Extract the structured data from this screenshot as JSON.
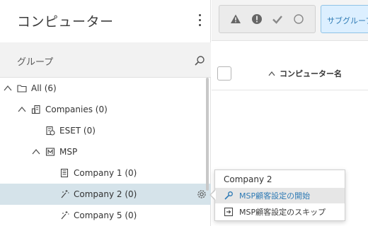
{
  "left_panel": {
    "title": "コンピューター",
    "group_label": "グループ"
  },
  "tree": [
    {
      "label": "All (6)",
      "icon": "folder-icon",
      "expanded": true
    },
    {
      "label": "Companies (0)",
      "icon": "building-group-icon",
      "expanded": true
    },
    {
      "label": "ESET (0)",
      "icon": "company-icon"
    },
    {
      "label": "MSP",
      "icon": "msp-icon",
      "expanded": true
    },
    {
      "label": "Company 1 (0)",
      "icon": "building-icon"
    },
    {
      "label": "Company 2 (0)",
      "icon": "wand-icon",
      "selected": true
    },
    {
      "label": "Company 5 (0)",
      "icon": "wand-icon"
    }
  ],
  "filters": {
    "subgroup_label": "サブグループ"
  },
  "table": {
    "column_header": "コンピューター名"
  },
  "context_menu": {
    "title": "Company 2",
    "items": [
      {
        "label": "MSP顧客設定の開始",
        "icon": "wrench-icon"
      },
      {
        "label": "MSP顧客設定のスキップ",
        "icon": "skip-icon"
      }
    ]
  },
  "colors": {
    "accent": "#2f7bb5",
    "selected_row": "#d5e3ea",
    "subgroup_bg": "#dcefff"
  }
}
